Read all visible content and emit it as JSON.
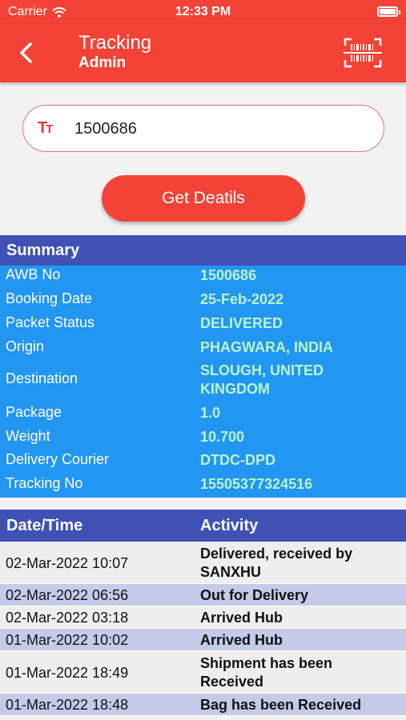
{
  "status_bar": {
    "carrier": "Carrier",
    "time": "12:33 PM"
  },
  "header": {
    "title": "Tracking",
    "subtitle": "Admin",
    "back_icon": "chevron-left-icon",
    "scan_icon": "barcode-scan-icon"
  },
  "search": {
    "value": "1500686",
    "icon": "text-format-icon"
  },
  "get_button": {
    "label": "Get Deatils"
  },
  "colors": {
    "primary": "#f44336",
    "header_blue": "#3f51b5",
    "summary_blue": "#2196f3",
    "value_green": "#b9f6ca",
    "row_even": "#eeeeee",
    "row_odd": "#c5cae9"
  },
  "summary": {
    "title": "Summary",
    "rows": [
      {
        "label": "AWB No",
        "value": "1500686"
      },
      {
        "label": "Booking Date",
        "value": "25-Feb-2022"
      },
      {
        "label": "Packet Status",
        "value": "DELIVERED"
      },
      {
        "label": "Origin",
        "value": "PHAGWARA, INDIA"
      },
      {
        "label": "Destination",
        "value": "SLOUGH, UNITED KINGDOM"
      },
      {
        "label": "Package",
        "value": "1.0"
      },
      {
        "label": "Weight",
        "value": "10.700"
      },
      {
        "label": "Delivery Courier",
        "value": "DTDC-DPD"
      },
      {
        "label": "Tracking No",
        "value": "15505377324516"
      }
    ]
  },
  "activity": {
    "headers": {
      "datetime": "Date/Time",
      "activity": "Activity"
    },
    "rows": [
      {
        "datetime": "02-Mar-2022 10:07",
        "activity": "Delivered, received by SANXHU"
      },
      {
        "datetime": "02-Mar-2022 06:56",
        "activity": "Out for Delivery"
      },
      {
        "datetime": "02-Mar-2022 03:18",
        "activity": "Arrived Hub"
      },
      {
        "datetime": "01-Mar-2022 10:02",
        "activity": "Arrived Hub"
      },
      {
        "datetime": "01-Mar-2022 18:49",
        "activity": "Shipment has been Received"
      },
      {
        "datetime": "01-Mar-2022 18:48",
        "activity": "Bag has been Received"
      }
    ]
  }
}
